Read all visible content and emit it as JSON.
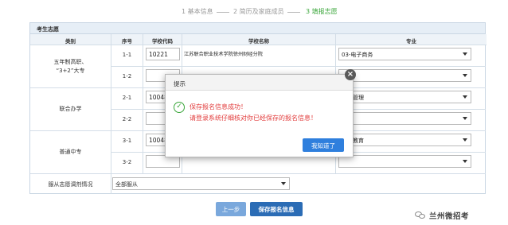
{
  "steps": {
    "step1": "1 基本信息",
    "step2": "2 简历及家庭成员",
    "step3": "3 填报志愿"
  },
  "panel": {
    "title": "考生志愿",
    "headers": {
      "category": "类别",
      "seq": "序号",
      "code": "学校代码",
      "name": "学校名称",
      "major": "专业"
    }
  },
  "groups": [
    {
      "category_line1": "五年制高职、",
      "category_line2": "“3+2”大专",
      "rows": [
        {
          "seq": "1-1",
          "code": "10221",
          "name": "江苏联合职业技术学院徐州财经分院",
          "major": "03-电子商务"
        },
        {
          "seq": "1-2",
          "code": "",
          "name": "",
          "major": ""
        }
      ]
    },
    {
      "category_line1": "联合办学",
      "category_line2": "",
      "rows": [
        {
          "seq": "2-1",
          "code": "10048",
          "name": "",
          "major": "酒店管理"
        },
        {
          "seq": "2-2",
          "code": "",
          "name": "",
          "major": ""
        }
      ]
    },
    {
      "category_line1": "普通中专",
      "category_line2": "",
      "rows": [
        {
          "seq": "3-1",
          "code": "10048",
          "name": "",
          "major": "学前教育"
        },
        {
          "seq": "3-2",
          "code": "",
          "name": "",
          "major": ""
        }
      ]
    }
  ],
  "adjust": {
    "label": "服从志愿调剂情况",
    "value": "全部服从"
  },
  "buttons": {
    "prev": "上一步",
    "save": "保存报名信息"
  },
  "watermark": {
    "text": "兰州微招考",
    "icon": "wechat-icon"
  },
  "dialog": {
    "title": "提示",
    "message1": "保存报名信息成功！",
    "message2": "请登录系统仔细核对你已经保存的报名信息！",
    "confirm": "我知道了",
    "close_glyph": "×",
    "check_glyph": "✓",
    "icon": "success-check-icon"
  },
  "colors": {
    "active_step": "#3aa63a",
    "dialog_message": "#e23c3c",
    "primary_button": "#2b6cb5",
    "confirm_button": "#2f7fdd"
  }
}
